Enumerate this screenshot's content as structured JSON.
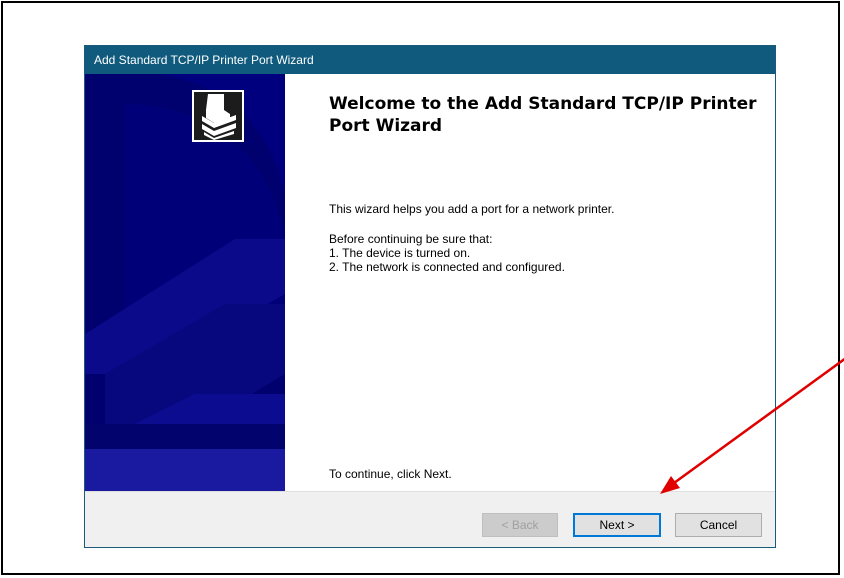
{
  "dialog": {
    "title": "Add Standard TCP/IP Printer Port Wizard"
  },
  "content": {
    "heading": "Welcome to the Add Standard TCP/IP Printer Port Wizard",
    "intro": "This wizard helps you add a port for a network printer.",
    "before": "Before continuing be sure that:",
    "step1": "1.  The device is turned on.",
    "step2": "2.  The network is connected and configured.",
    "continue": "To continue, click Next."
  },
  "buttons": {
    "back": "< Back",
    "next": "Next >",
    "cancel": "Cancel"
  },
  "colors": {
    "titlebar": "#0f5a7d",
    "banner": "#00006e",
    "annotation_arrow": "#e00000"
  },
  "icons": {
    "wizard": "printer-icon",
    "annotation": "red-arrow-annotation"
  }
}
